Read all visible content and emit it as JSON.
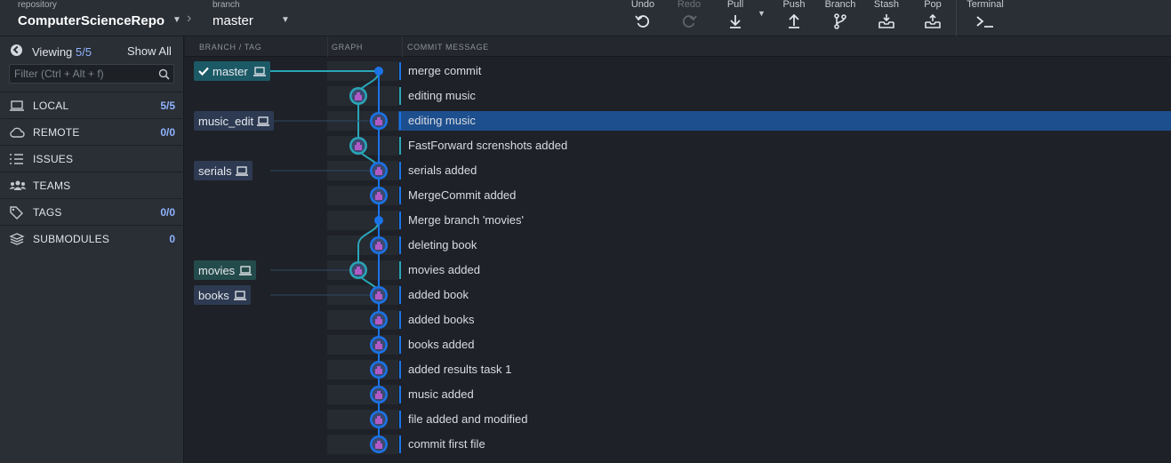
{
  "toolbar": {
    "repo_label": "repository",
    "repo_name": "ComputerScienceRepo",
    "branch_label": "branch",
    "branch_name": "master",
    "buttons": {
      "undo": "Undo",
      "redo": "Redo",
      "pull": "Pull",
      "push": "Push",
      "branch": "Branch",
      "stash": "Stash",
      "pop": "Pop",
      "terminal": "Terminal"
    }
  },
  "sidebar": {
    "viewing_label": "Viewing",
    "viewing_count": "5/5",
    "show_all": "Show All",
    "filter_placeholder": "Filter (Ctrl + Alt + f)",
    "items": [
      {
        "label": "LOCAL",
        "count": "5/5",
        "icon": "laptop-icon"
      },
      {
        "label": "REMOTE",
        "count": "0/0",
        "icon": "cloud-icon"
      },
      {
        "label": "ISSUES",
        "count": "",
        "icon": "list-icon"
      },
      {
        "label": "TEAMS",
        "count": "",
        "icon": "users-icon"
      },
      {
        "label": "TAGS",
        "count": "0/0",
        "icon": "tag-icon"
      },
      {
        "label": "SUBMODULES",
        "count": "0",
        "icon": "layers-icon"
      }
    ]
  },
  "columns": {
    "branch_tag": "BRANCH / TAG",
    "graph": "GRAPH",
    "commit_message": "COMMIT MESSAGE"
  },
  "refs": [
    {
      "name": "master",
      "row": 0,
      "current": true
    },
    {
      "name": "music_edit",
      "row": 2,
      "current": false
    },
    {
      "name": "serials",
      "row": 4,
      "current": false
    },
    {
      "name": "movies",
      "row": 8,
      "current": false
    },
    {
      "name": "books",
      "row": 9,
      "current": false
    }
  ],
  "commits": [
    {
      "message": "merge commit",
      "lane": 1,
      "merge": true
    },
    {
      "message": "editing music",
      "lane": 0,
      "merge": false
    },
    {
      "message": "editing music",
      "lane": 1,
      "merge": false,
      "selected": true
    },
    {
      "message": "FastForward screnshots added",
      "lane": 0,
      "merge": false
    },
    {
      "message": "serials added",
      "lane": 1,
      "merge": false
    },
    {
      "message": "MergeCommit added",
      "lane": 1,
      "merge": false
    },
    {
      "message": "Merge branch 'movies'",
      "lane": 1,
      "merge": true
    },
    {
      "message": "deleting book",
      "lane": 1,
      "merge": false
    },
    {
      "message": "movies added",
      "lane": 0,
      "merge": false
    },
    {
      "message": "added book",
      "lane": 1,
      "merge": false
    },
    {
      "message": "added books",
      "lane": 1,
      "merge": false
    },
    {
      "message": "books added",
      "lane": 1,
      "merge": false
    },
    {
      "message": "added results task 1",
      "lane": 1,
      "merge": false
    },
    {
      "message": "music added",
      "lane": 1,
      "merge": false
    },
    {
      "message": "file added and modified",
      "lane": 1,
      "merge": false
    },
    {
      "message": "commit first file",
      "lane": 1,
      "merge": false
    }
  ],
  "colors": {
    "lane_teal": "#2aa6b8",
    "lane_blue": "#1a74e8",
    "selected_row": "#1d4e8d",
    "count_accent": "#8fb4ff"
  }
}
